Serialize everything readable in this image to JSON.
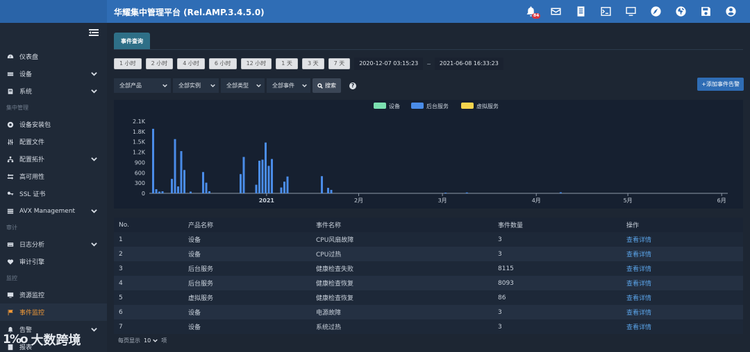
{
  "app": {
    "title": "华耀集中管理平台 (Rel.AMP.3.4.5.0)"
  },
  "header": {
    "notification_count": "84"
  },
  "sidebar": {
    "items": [
      {
        "label": "仪表盘"
      },
      {
        "label": "设备"
      },
      {
        "label": "系统"
      },
      {
        "section": "集中管理"
      },
      {
        "label": "设备安装包"
      },
      {
        "label": "配置文件"
      },
      {
        "label": "配置拓扑"
      },
      {
        "label": "高可用性"
      },
      {
        "label": "SSL 证书"
      },
      {
        "label": "AVX Management"
      },
      {
        "section": "审计"
      },
      {
        "label": "日志分析"
      },
      {
        "label": "审计引擎"
      },
      {
        "section": "监控"
      },
      {
        "label": "资源监控"
      },
      {
        "label": "事件监控"
      },
      {
        "label": "告警"
      },
      {
        "label": "报表"
      }
    ]
  },
  "watermark": {
    "text": "大数跨境",
    "logo": "1%o"
  },
  "main": {
    "tab": "事件查询",
    "time_buttons": [
      "1 小时",
      "2 小时",
      "4 小时",
      "6 小时",
      "12 小时",
      "1 天",
      "3 天",
      "7 天"
    ],
    "start_time": "2020-12-07 03:15:23",
    "end_time": "2021-06-08 16:33:23",
    "time_separator": "~",
    "filters": [
      "全部产品",
      "全部实例",
      "全部类型",
      "全部事件"
    ],
    "search_label": "搜索",
    "help_label": "?",
    "add_button": "添加事件告警"
  },
  "chart_data": {
    "type": "bar",
    "legend": [
      {
        "name": "设备",
        "color": "#7be0b0"
      },
      {
        "name": "后台服务",
        "color": "#4a8ce8"
      },
      {
        "name": "虚拟服务",
        "color": "#f5d44e"
      }
    ],
    "legend_position": "top-center",
    "yticks": [
      "0",
      "300",
      "600",
      "900",
      "1.2K",
      "1.5K",
      "1.8K",
      "2.1K"
    ],
    "ylim": [
      0,
      2100
    ],
    "xticks": [
      "2021",
      "2月",
      "3月",
      "4月",
      "5月",
      "6月"
    ],
    "series_name": "后台服务",
    "values": [
      1880,
      120,
      50,
      60,
      0,
      0,
      420,
      1580,
      200,
      1230,
      680,
      0,
      50,
      0,
      0,
      0,
      620,
      310,
      60,
      0,
      0,
      0,
      0,
      0,
      0,
      0,
      0,
      0,
      560,
      1060,
      0,
      0,
      0,
      250,
      950,
      980,
      1480,
      800,
      1000,
      0,
      0,
      170,
      340,
      490,
      0,
      0,
      0,
      0,
      0,
      0,
      0,
      0,
      0,
      0,
      500,
      0,
      160,
      100
    ],
    "minor_points": [
      {
        "x_frac": 0.508,
        "value": 20
      },
      {
        "x_frac": 0.545,
        "value": 25
      },
      {
        "x_frac": 0.708,
        "value": 30
      }
    ]
  },
  "table": {
    "headers": [
      "No.",
      "产品名称",
      "事件名称",
      "事件数量",
      "操作"
    ],
    "rows": [
      [
        "1",
        "设备",
        "CPU风扇故障",
        "3",
        "查看详情"
      ],
      [
        "2",
        "设备",
        "CPU过热",
        "3",
        "查看详情"
      ],
      [
        "3",
        "后台服务",
        "健康检查失败",
        "8115",
        "查看详情"
      ],
      [
        "4",
        "后台服务",
        "健康检查恢复",
        "8093",
        "查看详情"
      ],
      [
        "5",
        "虚拟服务",
        "健康检查恢复",
        "86",
        "查看详情"
      ],
      [
        "6",
        "设备",
        "电源故障",
        "3",
        "查看详情"
      ],
      [
        "7",
        "设备",
        "系统过热",
        "3",
        "查看详情"
      ]
    ]
  },
  "pager": {
    "prefix": "每页显示",
    "size": "10",
    "suffix": "项"
  }
}
